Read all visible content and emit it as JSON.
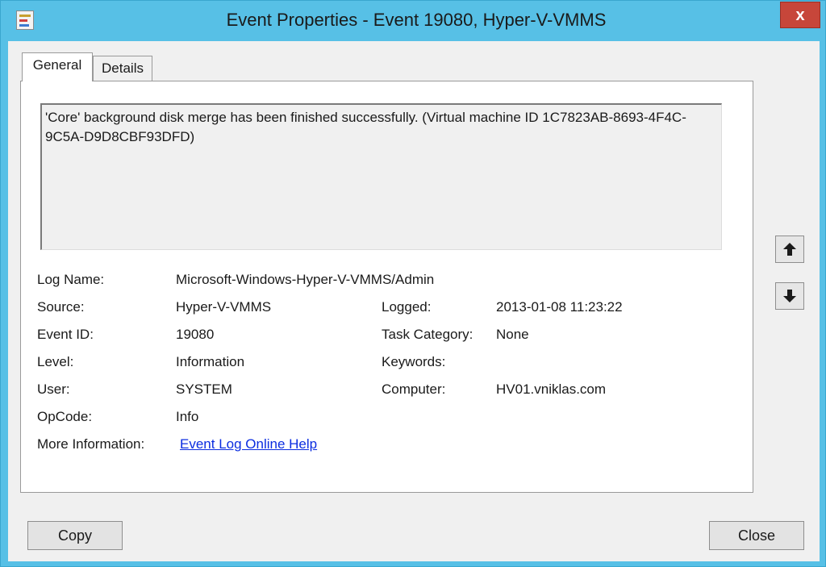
{
  "window": {
    "title": "Event Properties - Event 19080, Hyper-V-VMMS",
    "close_glyph": "x"
  },
  "tabs": [
    {
      "label": "General",
      "selected": true
    },
    {
      "label": "Details",
      "selected": false
    }
  ],
  "description": "'Core' background disk merge has been finished successfully. (Virtual machine ID 1C7823AB-8693-4F4C-9C5A-D9D8CBF93DFD)",
  "fields": {
    "log_name": {
      "label": "Log Name:",
      "value": "Microsoft-Windows-Hyper-V-VMMS/Admin"
    },
    "source": {
      "label": "Source:",
      "value": "Hyper-V-VMMS"
    },
    "logged": {
      "label": "Logged:",
      "value": "2013-01-08 11:23:22"
    },
    "event_id": {
      "label": "Event ID:",
      "value": "19080"
    },
    "task_category": {
      "label": "Task Category:",
      "value": "None"
    },
    "level": {
      "label": "Level:",
      "value": "Information"
    },
    "keywords": {
      "label": "Keywords:",
      "value": ""
    },
    "user": {
      "label": "User:",
      "value": "SYSTEM"
    },
    "computer": {
      "label": "Computer:",
      "value": "HV01.vniklas.com"
    },
    "opcode": {
      "label": "OpCode:",
      "value": "Info"
    },
    "more_info": {
      "label": "More Information:",
      "link": "Event Log Online Help"
    }
  },
  "buttons": {
    "copy": "Copy",
    "close": "Close"
  },
  "icons": {
    "app": "event-viewer-icon",
    "up": "arrow-up-icon",
    "down": "arrow-down-icon"
  },
  "colors": {
    "frame": "#57c0e6",
    "close_button": "#c7463a",
    "link": "#0b2de0"
  }
}
